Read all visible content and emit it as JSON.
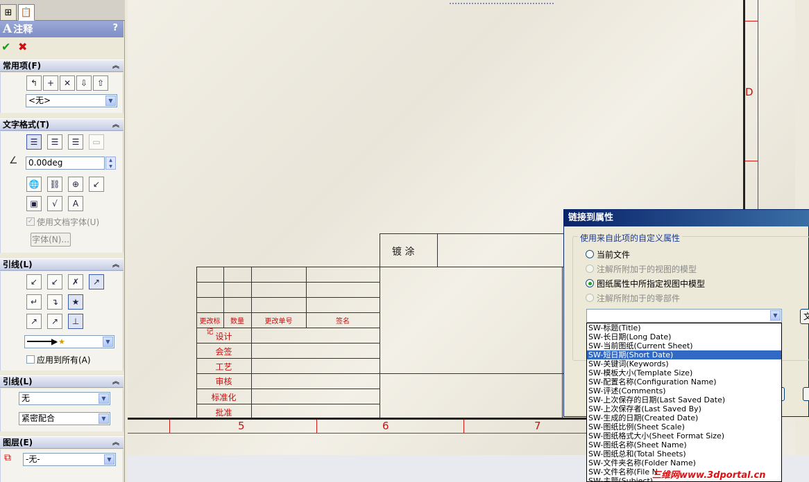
{
  "property_manager": {
    "title": "注释",
    "help": "?",
    "sections": {
      "favorites": {
        "title": "常用项(F)",
        "style_value": "<无>"
      },
      "text_format": {
        "title": "文字格式(T)",
        "angle_value": "0.00deg",
        "use_doc_font": "使用文档字体(U)",
        "font_button": "字体(N)..."
      },
      "leader": {
        "title": "引线(L)",
        "apply_all": "应用到所有(A)"
      },
      "leader2": {
        "title": "引线(L)",
        "value1": "无",
        "value2": "紧密配合"
      },
      "layer": {
        "title": "图层(E)",
        "value": "-无-"
      }
    }
  },
  "drawing": {
    "coating_label": "镀 涂",
    "table_headers": [
      "更改标记",
      "数量",
      "更改单号",
      "签名"
    ],
    "row_labels": [
      "设计",
      "会签",
      "工艺",
      "审核",
      "标准化",
      "批准"
    ],
    "zone_numbers": [
      "5",
      "6",
      "7"
    ],
    "zone_letter": "D"
  },
  "dialog": {
    "title": "链接到属性",
    "group_label": "使用来自此项的自定义属性",
    "radios": [
      {
        "label": "当前文件",
        "selected": false,
        "enabled": true
      },
      {
        "label": "注解所附加于的视图的模型",
        "selected": false,
        "enabled": false
      },
      {
        "label": "图纸属性中所指定视图中模型",
        "selected": true,
        "enabled": true
      },
      {
        "label": "注解所附加于的零部件",
        "selected": false,
        "enabled": false
      }
    ],
    "side_button_partial": "文",
    "list_items": [
      "SW-标题(Title)",
      "SW-长日期(Long Date)",
      "SW-当前图纸(Current Sheet)",
      "SW-短日期(Short Date)",
      "SW-关键词(Keywords)",
      "SW-模板大小(Template Size)",
      "SW-配置名称(Configuration Name)",
      "SW-评述(Comments)",
      "SW-上次保存的日期(Last Saved Date)",
      "SW-上次保存者(Last Saved By)",
      "SW-生成的日期(Created Date)",
      "SW-图纸比例(Sheet Scale)",
      "SW-图纸格式大小(Sheet Format Size)",
      "SW-图纸名称(Sheet Name)",
      "SW-图纸总和(Total Sheets)",
      "SW-文件夹名称(Folder Name)",
      "SW-文件名称(File N",
      "SW-主题(Subject)"
    ],
    "selected_index": 3
  },
  "watermark": "三维网www.3dportal.cn"
}
